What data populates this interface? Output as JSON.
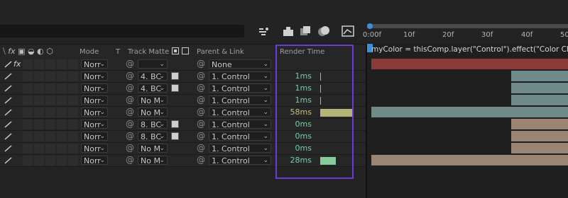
{
  "columns": {
    "mode": "Mode",
    "t": "T",
    "track_matte": "Track Matte",
    "parent_link": "Parent & Link",
    "render_time": "Render Time"
  },
  "ruler": {
    "ticks": [
      "0:00f",
      "10f",
      "20f",
      "30f",
      "40f",
      "50"
    ]
  },
  "expression": "myColor = thisComp.layer(\"Control\").effect(\"Color Choice\")(",
  "rows": [
    {
      "mode": "Norr",
      "matte": "",
      "parent": "None",
      "render_time": "",
      "bar": 0
    },
    {
      "mode": "Norr",
      "matte": "4. BC",
      "parent": "1. Control",
      "render_time": "1ms",
      "bar": 1
    },
    {
      "mode": "Norr",
      "matte": "4. BC",
      "parent": "1. Control",
      "render_time": "1ms",
      "bar": 1
    },
    {
      "mode": "Norr",
      "matte": "No M",
      "parent": "1. Control",
      "render_time": "1ms",
      "bar": 1
    },
    {
      "mode": "Norr",
      "matte": "No M",
      "parent": "1. Control",
      "render_time": "58ms",
      "bar": 58
    },
    {
      "mode": "Norr",
      "matte": "8. BC",
      "parent": "1. Control",
      "render_time": "0ms",
      "bar": 0
    },
    {
      "mode": "Norr",
      "matte": "8. BC",
      "parent": "1. Control",
      "render_time": "0ms",
      "bar": 0
    },
    {
      "mode": "Norr",
      "matte": "No M",
      "parent": "1. Control",
      "render_time": "0ms",
      "bar": 0
    },
    {
      "mode": "Norr",
      "matte": "No M",
      "parent": "1. Control",
      "render_time": "28ms",
      "bar": 28
    }
  ],
  "colors": {
    "render_green": "#6fd2a4",
    "render_gold": "#c8c07a",
    "bar_gold": "#b5b57a",
    "bar_green": "#86c99b",
    "highlight": "#6b3bd6",
    "track_red": "#8a3a38",
    "track_teal": "#6f8a88",
    "track_tan": "#9a8473"
  }
}
